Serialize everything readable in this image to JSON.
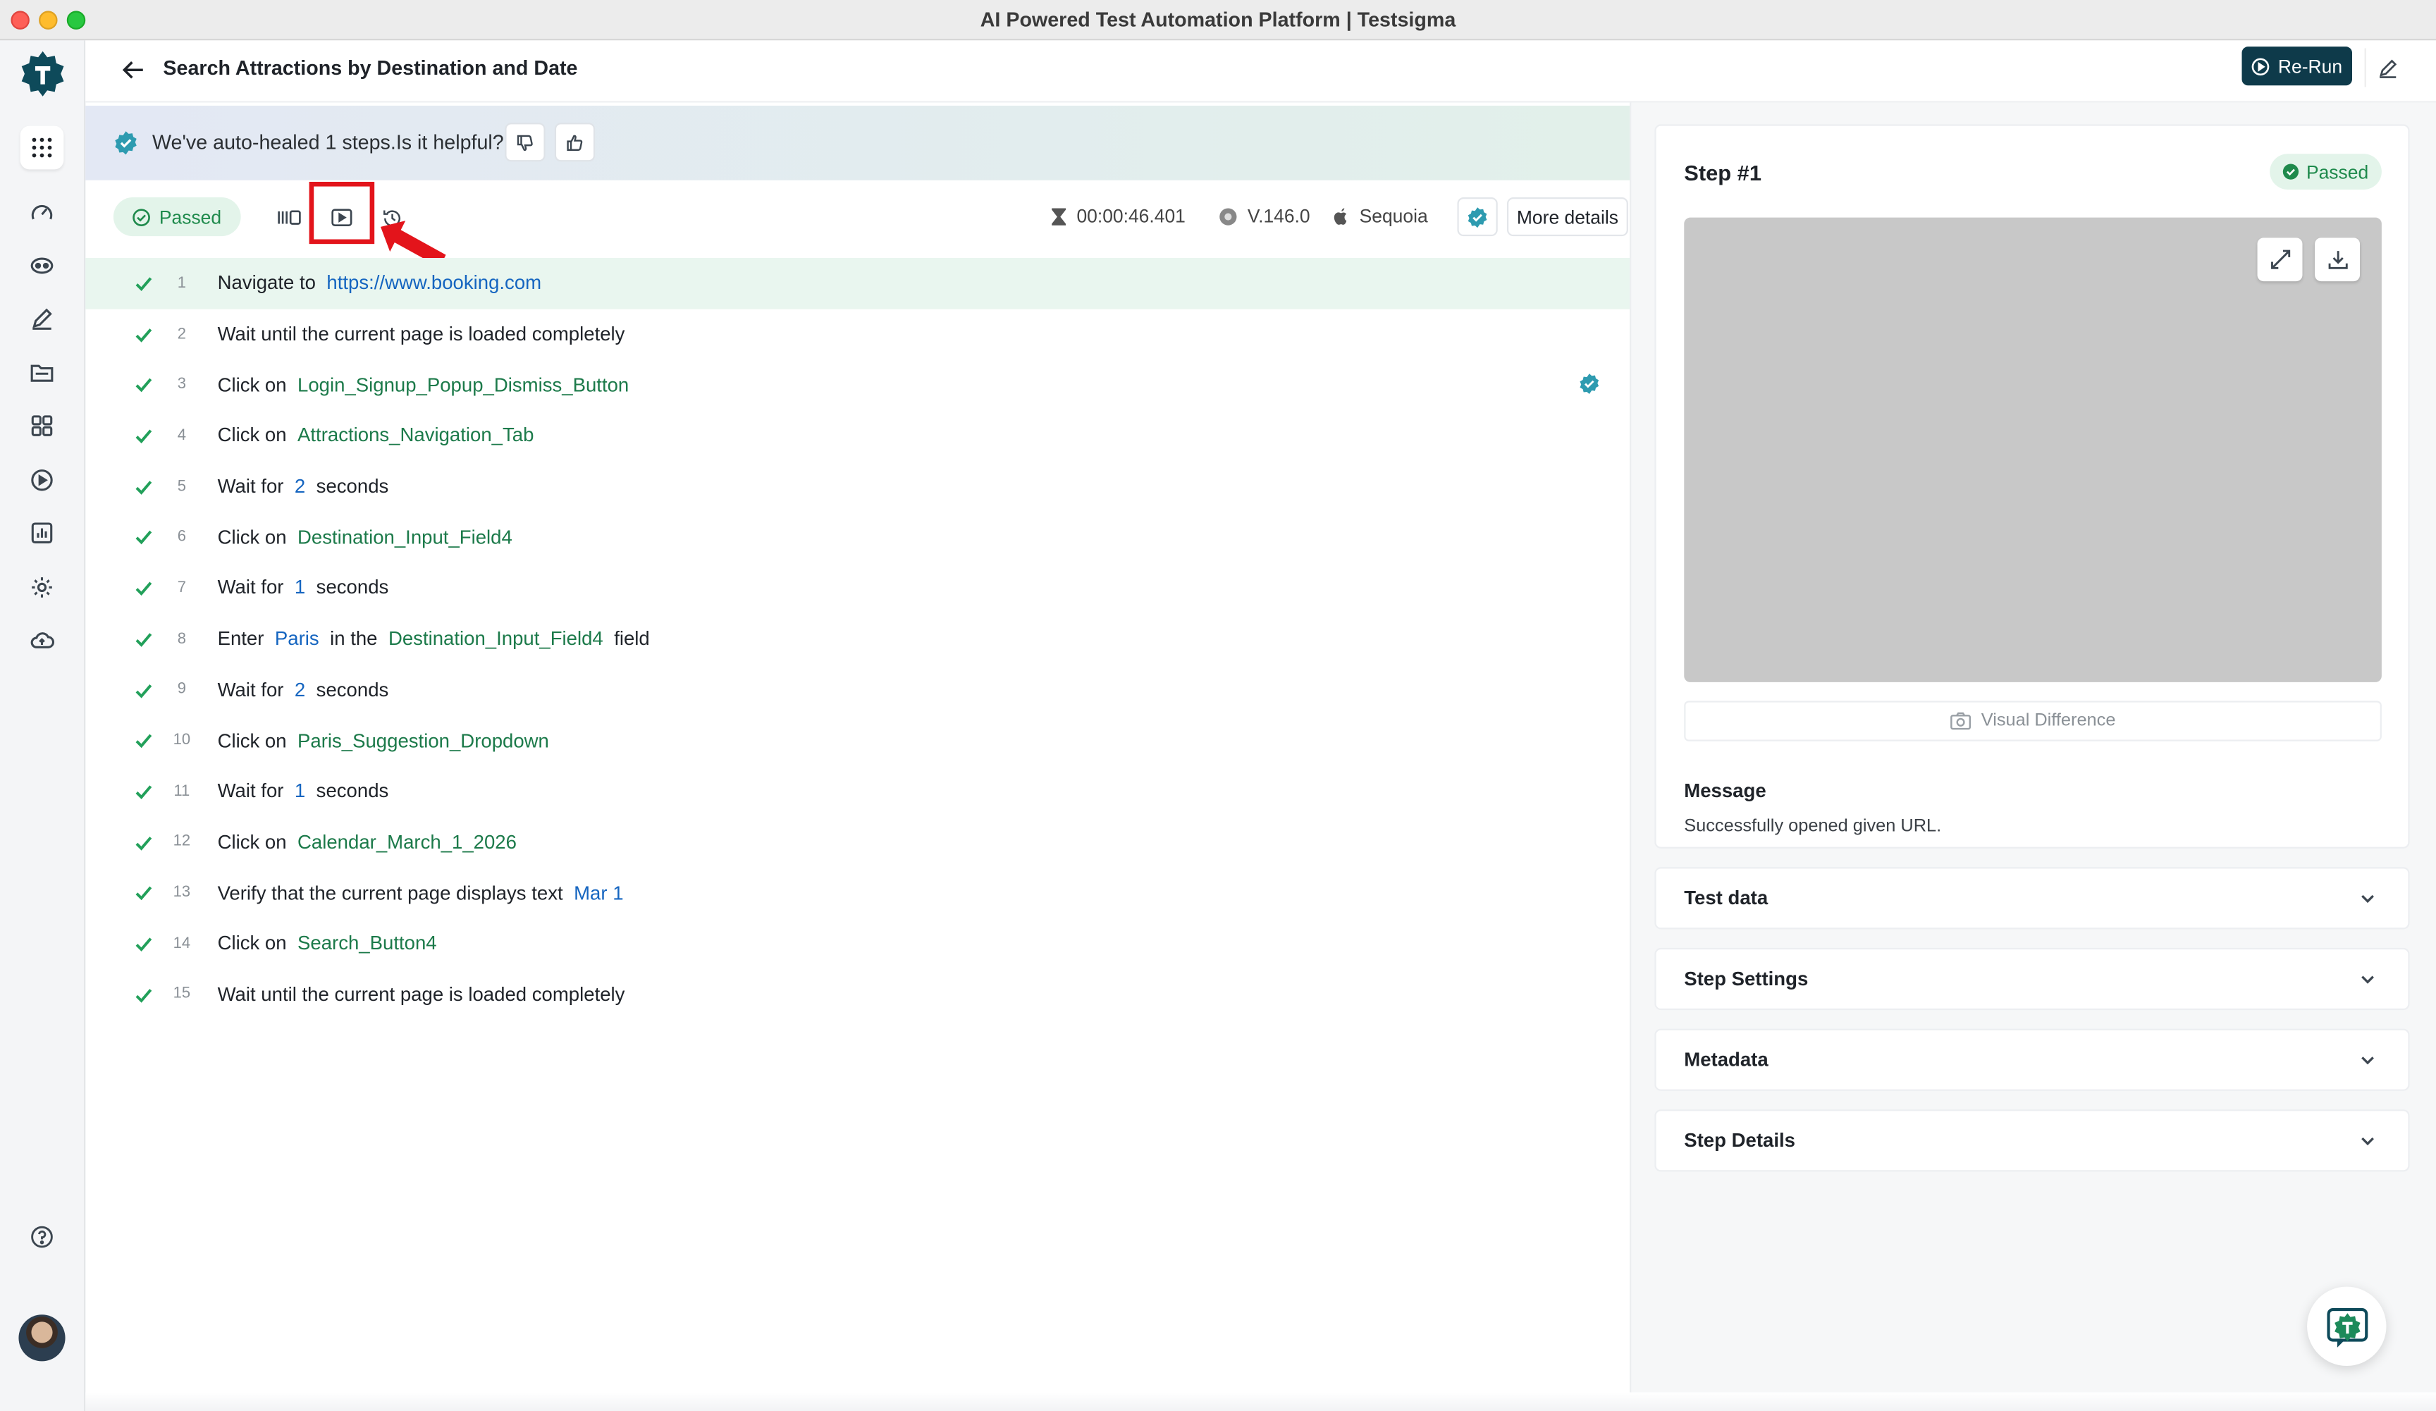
{
  "window": {
    "title": "AI Powered Test Automation Platform | Testsigma"
  },
  "header": {
    "page_title": "Search Attractions by Destination and Date",
    "rerun_label": "Re-Run"
  },
  "banner": {
    "text": "We've auto-healed 1 steps.Is it helpful?"
  },
  "toolbar": {
    "status": "Passed",
    "duration": "00:00:46.401",
    "browser_version": "V.146.0",
    "os": "Sequoia",
    "more_details": "More details"
  },
  "steps": [
    {
      "num": "1",
      "parts": [
        [
          "t",
          "Navigate to"
        ],
        [
          "link",
          "https://www.booking.com"
        ]
      ]
    },
    {
      "num": "2",
      "parts": [
        [
          "t",
          "Wait until the current page is loaded completely"
        ]
      ]
    },
    {
      "num": "3",
      "parts": [
        [
          "t",
          "Click on"
        ],
        [
          "el",
          "Login_Signup_Popup_Dismiss_Button"
        ]
      ],
      "healed": true
    },
    {
      "num": "4",
      "parts": [
        [
          "t",
          "Click on"
        ],
        [
          "el",
          "Attractions_Navigation_Tab"
        ]
      ]
    },
    {
      "num": "5",
      "parts": [
        [
          "t",
          "Wait for"
        ],
        [
          "val",
          "2"
        ],
        [
          "t",
          "seconds"
        ]
      ]
    },
    {
      "num": "6",
      "parts": [
        [
          "t",
          "Click on"
        ],
        [
          "el",
          "Destination_Input_Field4"
        ]
      ]
    },
    {
      "num": "7",
      "parts": [
        [
          "t",
          "Wait for"
        ],
        [
          "val",
          "1"
        ],
        [
          "t",
          "seconds"
        ]
      ]
    },
    {
      "num": "8",
      "parts": [
        [
          "t",
          "Enter"
        ],
        [
          "val",
          "Paris"
        ],
        [
          "t",
          "in the"
        ],
        [
          "el",
          "Destination_Input_Field4"
        ],
        [
          "t",
          "field"
        ]
      ]
    },
    {
      "num": "9",
      "parts": [
        [
          "t",
          "Wait for"
        ],
        [
          "val",
          "2"
        ],
        [
          "t",
          "seconds"
        ]
      ]
    },
    {
      "num": "10",
      "parts": [
        [
          "t",
          "Click on"
        ],
        [
          "el",
          "Paris_Suggestion_Dropdown"
        ]
      ]
    },
    {
      "num": "11",
      "parts": [
        [
          "t",
          "Wait for"
        ],
        [
          "val",
          "1"
        ],
        [
          "t",
          "seconds"
        ]
      ]
    },
    {
      "num": "12",
      "parts": [
        [
          "t",
          "Click on"
        ],
        [
          "el",
          "Calendar_March_1_2026"
        ]
      ]
    },
    {
      "num": "13",
      "parts": [
        [
          "t",
          "Verify that the current page displays text"
        ],
        [
          "val",
          "Mar 1"
        ]
      ]
    },
    {
      "num": "14",
      "parts": [
        [
          "t",
          "Click on"
        ],
        [
          "el",
          "Search_Button4"
        ]
      ]
    },
    {
      "num": "15",
      "parts": [
        [
          "t",
          "Wait until the current page is loaded completely"
        ]
      ]
    }
  ],
  "detail": {
    "step_title": "Step #1",
    "status": "Passed",
    "visual_difference": "Visual Difference",
    "message_label": "Message",
    "message_text": "Successfully opened given URL.",
    "sections": [
      "Test data",
      "Step Settings",
      "Metadata",
      "Step Details"
    ]
  },
  "colors": {
    "accent": "#0e3a4a",
    "passed": "#1f8a4c",
    "element": "#1c7a4a",
    "value": "#1565c0",
    "highlight": "#e3141b"
  },
  "icons": {
    "sidebar": [
      "apps-grid-icon",
      "dashboard-gauge-icon",
      "ai-agent-icon",
      "edit-pencil-icon",
      "folder-icon",
      "modules-grid-icon",
      "run-play-icon",
      "reports-chart-icon",
      "settings-gear-icon",
      "cloud-upload-icon"
    ]
  }
}
